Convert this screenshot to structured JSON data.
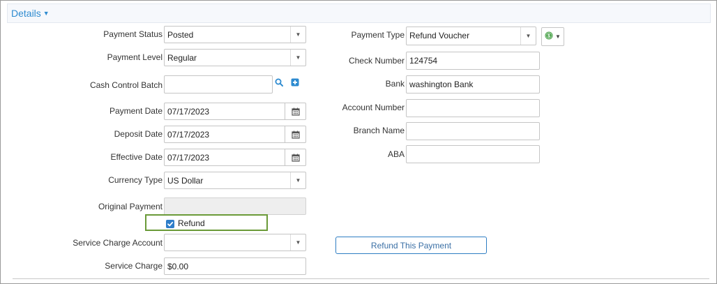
{
  "section": {
    "title": "Details"
  },
  "left": {
    "payment_status": {
      "label": "Payment Status",
      "value": "Posted"
    },
    "payment_level": {
      "label": "Payment Level",
      "value": "Regular"
    },
    "cash_control_batch": {
      "label": "Cash Control Batch",
      "value": ""
    },
    "payment_date": {
      "label": "Payment Date",
      "value": "07/17/2023"
    },
    "deposit_date": {
      "label": "Deposit Date",
      "value": "07/17/2023"
    },
    "effective_date": {
      "label": "Effective Date",
      "value": "07/17/2023"
    },
    "currency_type": {
      "label": "Currency Type",
      "value": "US Dollar"
    },
    "original_payment": {
      "label": "Original Payment",
      "value": ""
    },
    "refund": {
      "label": "Refund",
      "checked": true
    },
    "service_charge_account": {
      "label": "Service Charge Account",
      "value": ""
    },
    "service_charge": {
      "label": "Service Charge",
      "value": "$0.00"
    }
  },
  "right": {
    "payment_type": {
      "label": "Payment Type",
      "value": "Refund Voucher"
    },
    "check_number": {
      "label": "Check Number",
      "value": "124754"
    },
    "bank": {
      "label": "Bank",
      "value": "washington Bank"
    },
    "account_number": {
      "label": "Account Number",
      "value": ""
    },
    "branch_name": {
      "label": "Branch Name",
      "value": ""
    },
    "aba": {
      "label": "ABA",
      "value": ""
    },
    "refund_button": {
      "label": "Refund This Payment"
    }
  },
  "icons": {
    "search": "search-icon",
    "add": "plus-square-icon",
    "calendar": "calendar-icon",
    "dropdown": "chevron-down-icon",
    "payment_type_currency": "dollar-coin-icon"
  },
  "colors": {
    "accent": "#2e8bd0",
    "refund_highlight": "#6a9a38",
    "checkbox": "#2f7ec9",
    "coin": "#3c9a3c"
  }
}
